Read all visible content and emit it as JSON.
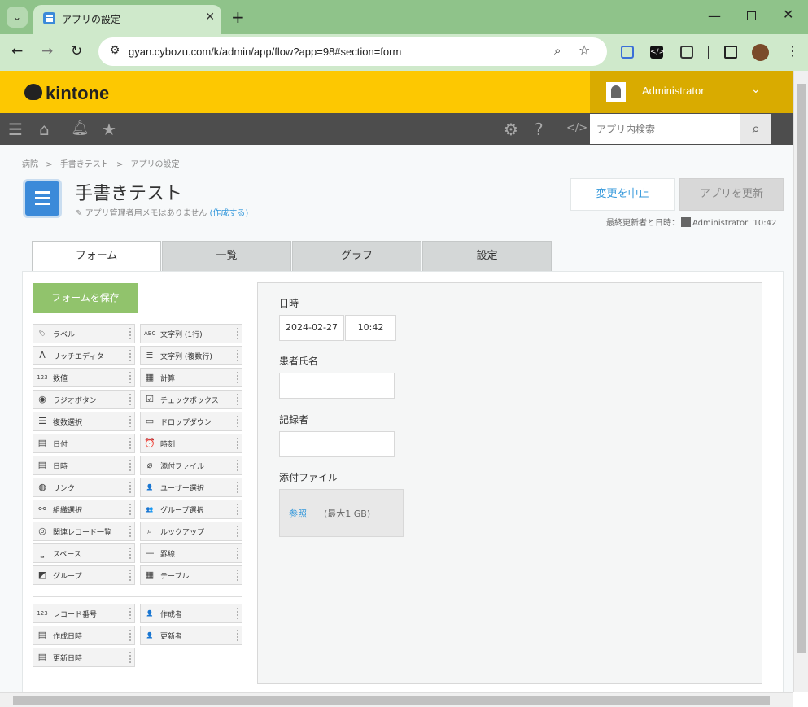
{
  "browser": {
    "tab_title": "アプリの設定",
    "url": "gyan.cybozu.com/k/admin/app/flow?app=98#section=form"
  },
  "header": {
    "logo": "kintone",
    "user_name": "Administrator",
    "search_placeholder": "アプリ内検索"
  },
  "breadcrumb": [
    "病院",
    ">",
    "手書きテスト",
    ">",
    "アプリの設定"
  ],
  "app": {
    "title": "手書きテスト",
    "memo": "アプリ管理者用メモはありません",
    "memo_link": "(作成する)",
    "cancel_label": "変更を中止",
    "update_label": "アプリを更新",
    "last_updated_label": "最終更新者と日時：",
    "last_updated_user": "Administrator",
    "last_updated_time": "10:42"
  },
  "tabs": [
    "フォーム",
    "一覧",
    "グラフ",
    "設定"
  ],
  "form": {
    "save_label": "フォームを保存",
    "palette": [
      {
        "label": "ラベル",
        "icon": "label-icon",
        "glyph": "🏷"
      },
      {
        "label": "文字列 (1行)",
        "icon": "text-single-icon",
        "glyph": "ABC"
      },
      {
        "label": "リッチエディター",
        "icon": "rich-editor-icon",
        "glyph": "A"
      },
      {
        "label": "文字列 (複数行)",
        "icon": "text-multi-icon",
        "glyph": "≣"
      },
      {
        "label": "数値",
        "icon": "number-icon",
        "glyph": "123"
      },
      {
        "label": "計算",
        "icon": "calc-icon",
        "glyph": "▦"
      },
      {
        "label": "ラジオボタン",
        "icon": "radio-icon",
        "glyph": "◉"
      },
      {
        "label": "チェックボックス",
        "icon": "checkbox-icon",
        "glyph": "☑"
      },
      {
        "label": "複数選択",
        "icon": "multi-select-icon",
        "glyph": "☰"
      },
      {
        "label": "ドロップダウン",
        "icon": "dropdown-icon",
        "glyph": "▭"
      },
      {
        "label": "日付",
        "icon": "date-icon",
        "glyph": "▤"
      },
      {
        "label": "時刻",
        "icon": "time-icon",
        "glyph": "⏰"
      },
      {
        "label": "日時",
        "icon": "datetime-icon",
        "glyph": "▤"
      },
      {
        "label": "添付ファイル",
        "icon": "attachment-icon",
        "glyph": "⌀"
      },
      {
        "label": "リンク",
        "icon": "link-icon",
        "glyph": "◍"
      },
      {
        "label": "ユーザー選択",
        "icon": "user-select-icon",
        "glyph": "👤"
      },
      {
        "label": "組織選択",
        "icon": "org-select-icon",
        "glyph": "⚯"
      },
      {
        "label": "グループ選択",
        "icon": "group-select-icon",
        "glyph": "👥"
      },
      {
        "label": "関連レコード一覧",
        "icon": "related-records-icon",
        "glyph": "◎"
      },
      {
        "label": "ルックアップ",
        "icon": "lookup-icon",
        "glyph": "⌕"
      },
      {
        "label": "スペース",
        "icon": "space-icon",
        "glyph": "⎵"
      },
      {
        "label": "罫線",
        "icon": "border-icon",
        "glyph": "—"
      },
      {
        "label": "グループ",
        "icon": "group-icon",
        "glyph": "◩"
      },
      {
        "label": "テーブル",
        "icon": "table-icon",
        "glyph": "▦"
      }
    ],
    "system_fields": [
      {
        "label": "レコード番号",
        "icon": "record-number-icon",
        "glyph": "123"
      },
      {
        "label": "作成者",
        "icon": "creator-icon",
        "glyph": "👤"
      },
      {
        "label": "作成日時",
        "icon": "created-time-icon",
        "glyph": "▤"
      },
      {
        "label": "更新者",
        "icon": "modifier-icon",
        "glyph": "👤"
      },
      {
        "label": "更新日時",
        "icon": "updated-time-icon",
        "glyph": "▤"
      }
    ],
    "fields": {
      "datetime_label": "日時",
      "date_value": "2024-02-27",
      "time_value": "10:42",
      "patient_label": "患者氏名",
      "recorder_label": "記録者",
      "attachment_label": "添付ファイル",
      "browse_label": "参照",
      "max_size": "(最大1 GB)"
    }
  }
}
